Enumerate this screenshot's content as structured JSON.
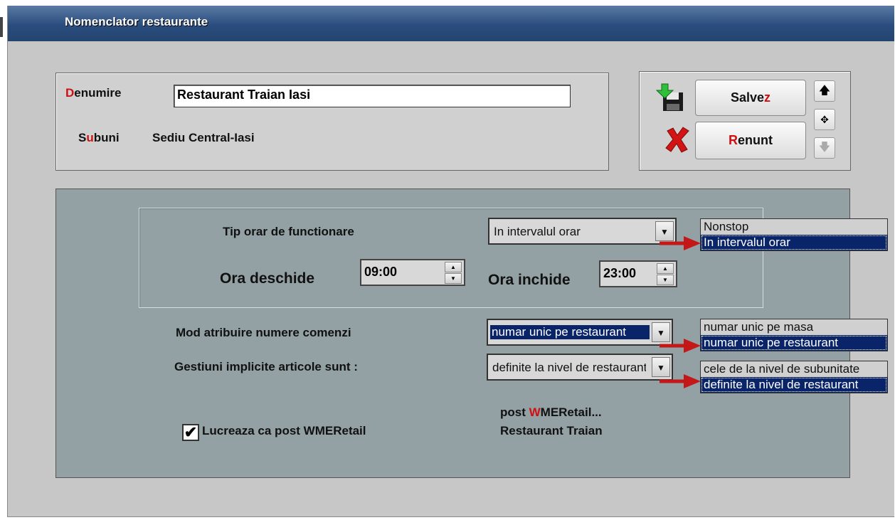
{
  "window": {
    "title": "Nomenclator restaurante"
  },
  "top": {
    "denumire_hot": "D",
    "denumire_rest": "enumire",
    "denumire_value": "Restaurant Traian Iasi",
    "subuni_first": "S",
    "subuni_hot": "u",
    "subuni_rest": "buni",
    "subuni_value": "Sediu Central-Iasi"
  },
  "buttons": {
    "save_main": "Salve",
    "save_hot": "z",
    "cancel_hot": "R",
    "cancel_rest": "enunt"
  },
  "schedule": {
    "type_label": "Tip orar de functionare",
    "type_value": "In intervalul orar",
    "type_options": [
      "Nonstop",
      "In intervalul orar"
    ],
    "open_label": "Ora deschide",
    "open_value": "09:00",
    "close_label": "Ora inchide",
    "close_value": "23:00"
  },
  "orders": {
    "label": "Mod atribuire numere comenzi",
    "value": "numar unic pe restaurant",
    "options": [
      "numar unic pe masa",
      "numar unic pe restaurant"
    ]
  },
  "stock": {
    "label": "Gestiuni implicite articole sunt  :",
    "value": "definite la nivel de restaurant",
    "options": [
      "cele de la nivel de subunitate",
      "definite la nivel de restaurant"
    ]
  },
  "post": {
    "checkbox_label": "Lucreaza ca post WMERetail",
    "checked": true,
    "check_glyph": "✔",
    "name_prefix": "post ",
    "name_hot": "W",
    "name_rest": "MERetail...",
    "restaurant": "Restaurant Traian"
  },
  "colors": {
    "accent_red": "#d01010",
    "selection": "#0a246a",
    "title_bar": "#2a4d7e"
  }
}
